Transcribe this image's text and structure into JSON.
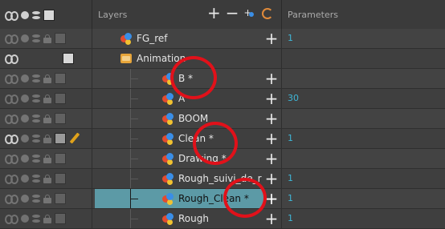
{
  "header": {
    "layers_title": "Layers",
    "parameters_title": "Parameters"
  },
  "layers": [
    {
      "name": "FG_ref",
      "type": "drawing",
      "param": "1"
    },
    {
      "name": "Animation",
      "type": "folder",
      "param": ""
    },
    {
      "name": "B *",
      "type": "drawing",
      "param": ""
    },
    {
      "name": "A",
      "type": "drawing",
      "param": "30"
    },
    {
      "name": "BOOM",
      "type": "drawing",
      "param": ""
    },
    {
      "name": "Clean *",
      "type": "drawing",
      "param": "1"
    },
    {
      "name": "Drawing *",
      "type": "drawing",
      "param": ""
    },
    {
      "name": "Rough_suivi_de_r",
      "type": "drawing",
      "param": "1"
    },
    {
      "name": "Rough_Clean *",
      "type": "drawing",
      "param": "1"
    },
    {
      "name": "Rough",
      "type": "drawing",
      "param": "1"
    }
  ],
  "colors": {
    "accent": "#3fb6d6",
    "selection": "#5c9aa6",
    "annotation": "#e1111a"
  }
}
